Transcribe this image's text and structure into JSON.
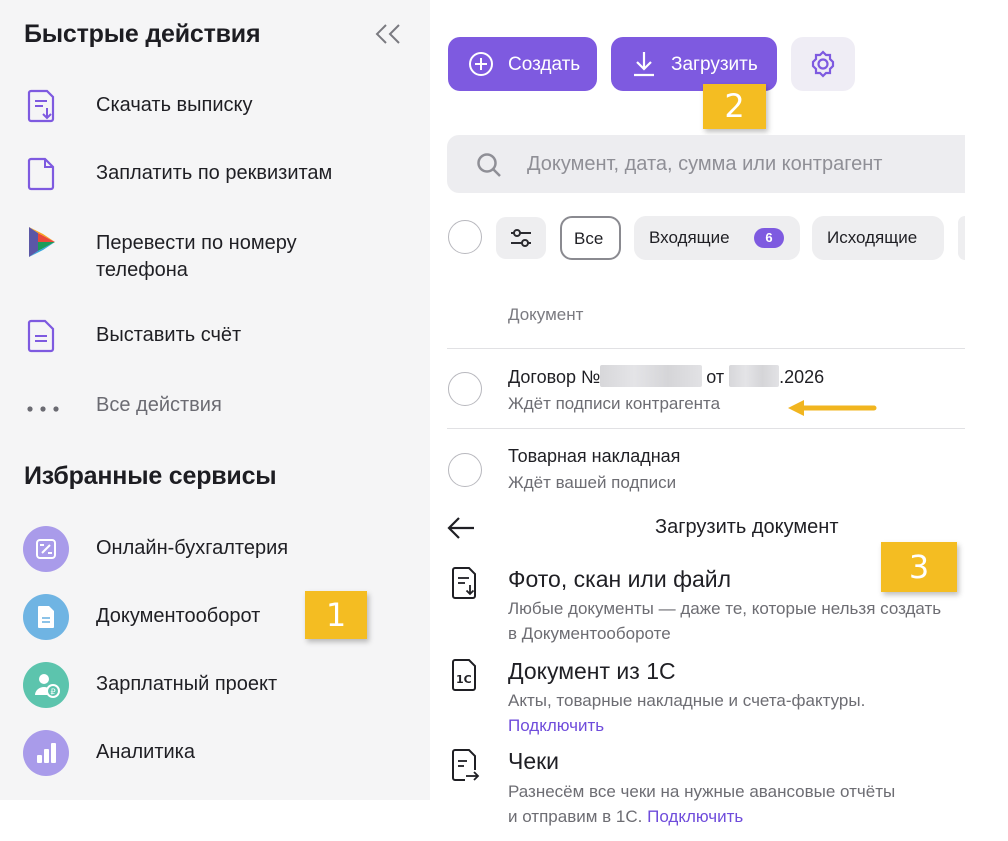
{
  "quick_actions": {
    "title": "Быстрые действия",
    "items": [
      {
        "label": "Скачать выписку",
        "icon": "statement-download-icon"
      },
      {
        "label": "Заплатить по реквизитам",
        "icon": "document-icon"
      },
      {
        "label_line1": "Перевести по номеру",
        "label_line2": "телефона",
        "icon": "sbp-logo-icon"
      },
      {
        "label": "Выставить счёт",
        "icon": "invoice-icon"
      },
      {
        "label": "Все действия",
        "icon": "more-dots-icon"
      }
    ]
  },
  "favorites": {
    "title": "Избранные сервисы",
    "items": [
      {
        "label": "Онлайн-бухгалтерия",
        "icon": "accounting-icon",
        "color": "#a99bea"
      },
      {
        "label": "Документооборот",
        "icon": "document-flow-icon",
        "color": "#6fb4e3"
      },
      {
        "label": "Зарплатный проект",
        "icon": "payroll-icon",
        "color": "#5cc4ad"
      },
      {
        "label": "Аналитика",
        "icon": "analytics-icon",
        "color": "#a99bea"
      }
    ]
  },
  "callouts": {
    "one": "1",
    "two": "2",
    "three": "3"
  },
  "toolbar": {
    "create_label": "Создать",
    "upload_label": "Загрузить"
  },
  "search": {
    "placeholder": "Документ, дата, сумма или контрагент"
  },
  "filters": {
    "all": "Все",
    "incoming": "Входящие",
    "incoming_count": "6",
    "outgoing": "Исходящие"
  },
  "table": {
    "column_header": "Документ",
    "rows": [
      {
        "title_prefix": "Договор №",
        "title_mid": "от",
        "title_suffix": ".2026",
        "status": "Ждёт подписи контрагента"
      },
      {
        "title": "Товарная накладная",
        "status": "Ждёт вашей подписи"
      }
    ]
  },
  "upload_panel": {
    "title": "Загрузить документ",
    "options": [
      {
        "title": "Фото, скан или файл",
        "desc_line1": "Любые документы — даже те, которые нельзя создать",
        "desc_line2": "в Документообороте",
        "icon": "file-upload-icon"
      },
      {
        "title": "Документ из 1С",
        "desc_line1": "Акты, товарные накладные и счета-фактуры.",
        "link": "Подключить",
        "icon": "1c-icon"
      },
      {
        "title": "Чеки",
        "desc_line1": "Разнесём все чеки на нужные авансовые отчёты",
        "desc_line2": "и отправим в 1С.",
        "link": "Подключить",
        "icon": "receipt-icon"
      }
    ]
  },
  "colors": {
    "accent": "#7e5ae0",
    "callout": "#f4bd22",
    "arrow": "#f1b51f"
  }
}
